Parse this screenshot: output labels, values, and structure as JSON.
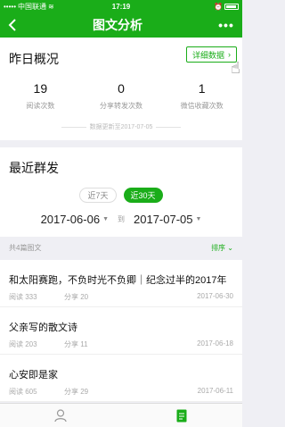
{
  "status": {
    "carrier": "中国联通",
    "time": "17:19"
  },
  "nav": {
    "title": "图文分析",
    "more": "•••"
  },
  "overview": {
    "title": "昨日概况",
    "detail_label": "详细数据",
    "stats": [
      {
        "value": "19",
        "label": "阅读次数"
      },
      {
        "value": "0",
        "label": "分享转发次数"
      },
      {
        "value": "1",
        "label": "微信收藏次数"
      }
    ],
    "update_note": "数据更新至2017-07-05"
  },
  "recent": {
    "title": "最近群发",
    "tabs": [
      "近7天",
      "近30天"
    ],
    "start_date": "2017-06-06",
    "end_date": "2017-07-05",
    "separator": "到"
  },
  "list": {
    "count_label": "共4篇图文",
    "sort_label": "排序"
  },
  "articles": [
    {
      "title": "和太阳赛跑，不负时光不负卿｜纪念过半的2017年",
      "read": "阅读 333",
      "share": "分享 20",
      "date": "2017-06-30"
    },
    {
      "title": "父亲写的散文诗",
      "read": "阅读 203",
      "share": "分享 11",
      "date": "2017-06-18"
    },
    {
      "title": "心安即是家",
      "read": "阅读 605",
      "share": "分享 29",
      "date": "2017-06-11"
    }
  ]
}
